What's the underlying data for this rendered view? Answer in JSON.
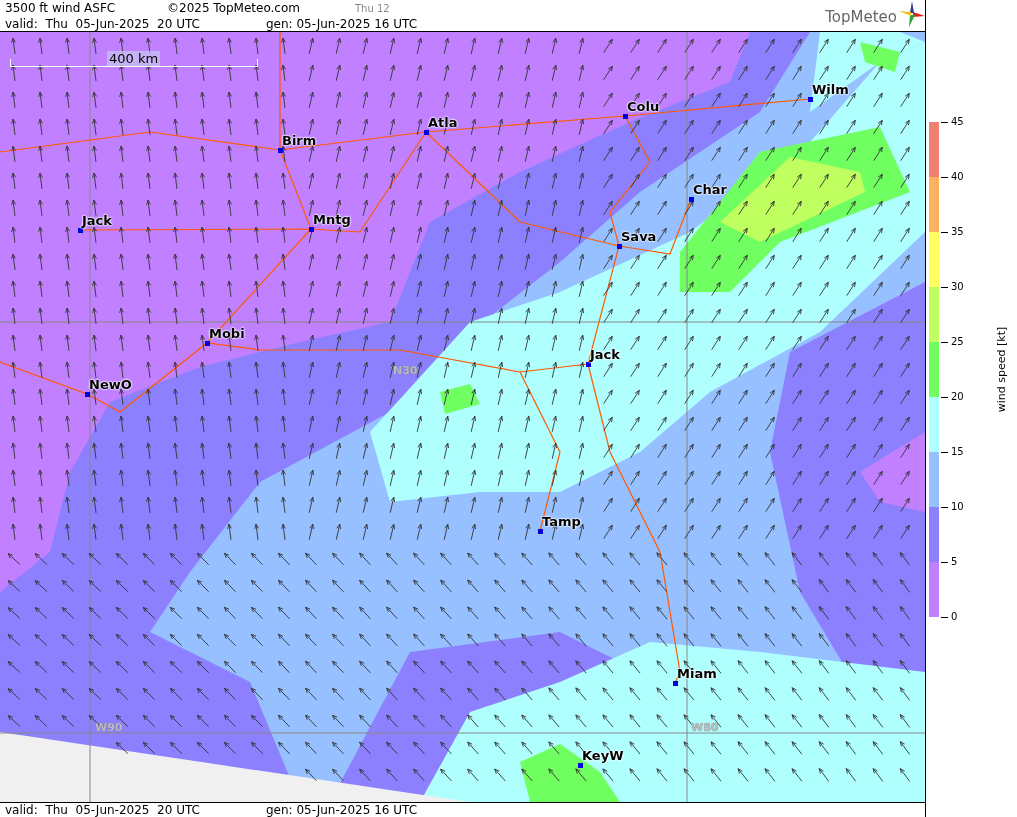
{
  "header": {
    "title": "3500 ft wind ASFC",
    "copyright": "©2025 TopMeteo.com",
    "step": "Thu 12",
    "valid": "valid:  Thu  05-Jun-2025  20 UTC",
    "generated": "gen: 05-Jun-2025 16 UTC",
    "logo": "TopMeteo"
  },
  "map": {
    "scale_label": "400 km",
    "cities": [
      {
        "name": "Birm"
      },
      {
        "name": "Atla"
      },
      {
        "name": "Colu"
      },
      {
        "name": "Wilm"
      },
      {
        "name": "Char"
      },
      {
        "name": "Sava"
      },
      {
        "name": "Jack"
      },
      {
        "name": "Mntg"
      },
      {
        "name": "Jack"
      },
      {
        "name": "Mobi"
      },
      {
        "name": "NewO"
      },
      {
        "name": "Tamp"
      },
      {
        "name": "Miam"
      },
      {
        "name": "KeyW"
      }
    ],
    "grid_labels": [
      "N30",
      "W90",
      "W80"
    ]
  },
  "legend": {
    "title": "wind speed [kt]",
    "bands": [
      {
        "color": "#f08070"
      },
      {
        "color": "#ffb060"
      },
      {
        "color": "#ffff60"
      },
      {
        "color": "#c0ff60"
      },
      {
        "color": "#70ff60"
      },
      {
        "color": "#b0ffff"
      },
      {
        "color": "#96c0ff"
      },
      {
        "color": "#8c80ff"
      },
      {
        "color": "#c080ff"
      }
    ],
    "ticks": [
      "45",
      "40",
      "35",
      "30",
      "25",
      "20",
      "15",
      "10",
      "5",
      "0"
    ]
  },
  "footer": {
    "valid": "valid:  Thu  05-Jun-2025  20 UTC",
    "generated": "gen: 05-Jun-2025 16 UTC"
  }
}
